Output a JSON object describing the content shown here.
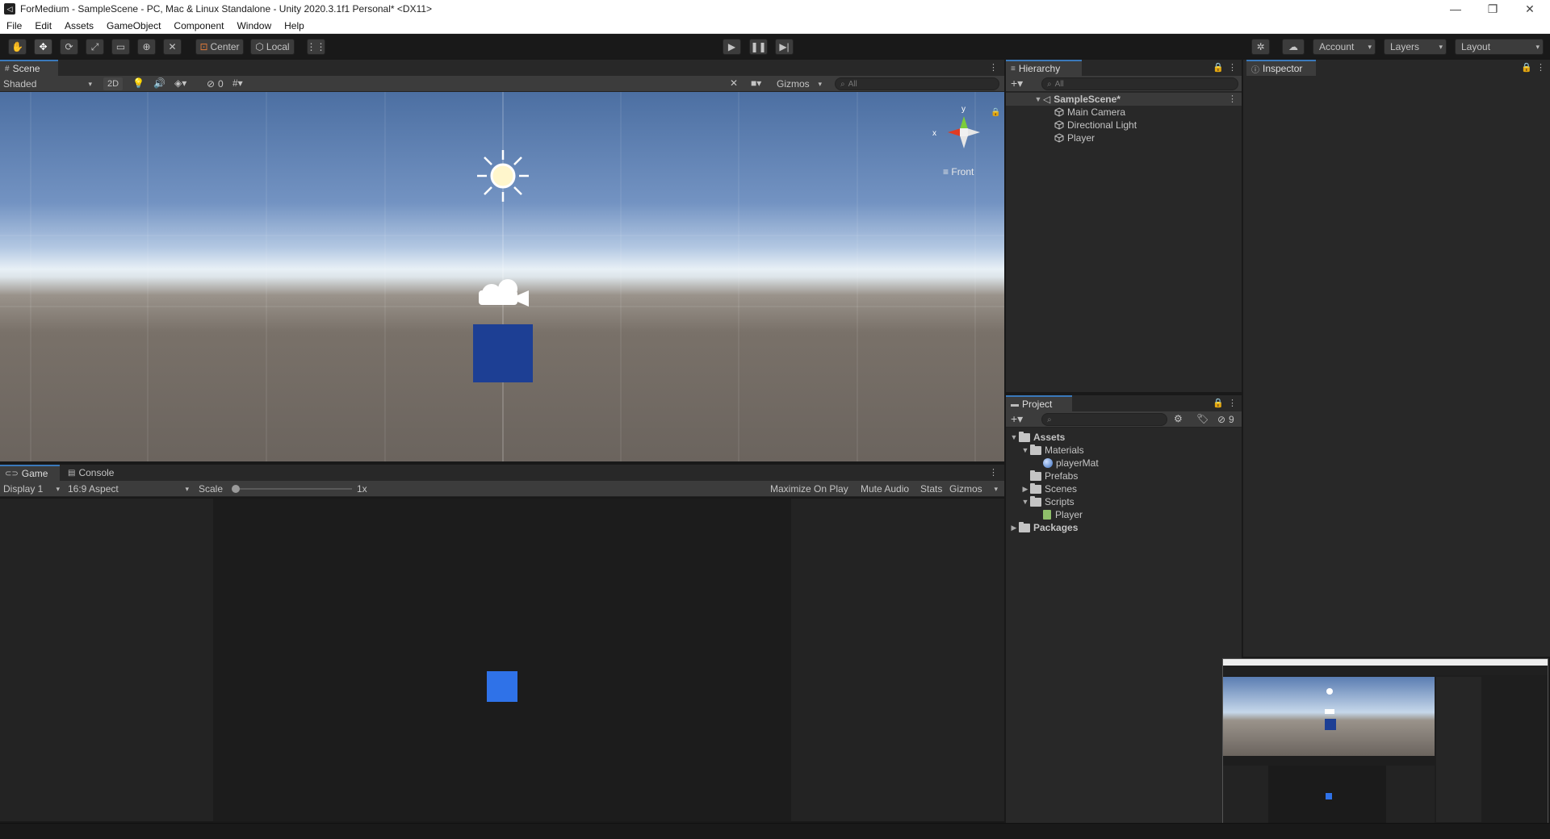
{
  "window": {
    "title": "ForMedium - SampleScene - PC, Mac & Linux Standalone - Unity 2020.3.1f1 Personal* <DX11>",
    "controls": [
      "—",
      "❐",
      "✕"
    ]
  },
  "menu": [
    "File",
    "Edit",
    "Assets",
    "GameObject",
    "Component",
    "Window",
    "Help"
  ],
  "toolbar": {
    "pivot_label": "Center",
    "space_label": "Local",
    "account_label": "Account",
    "layers_label": "Layers",
    "layout_label": "Layout"
  },
  "scene": {
    "tab_label": "Scene",
    "shading_mode": "Shaded",
    "mode_2d": "2D",
    "hidden_count": "0",
    "gizmos_label": "Gizmos",
    "search_placeholder": "All",
    "gizmo_axis_y": "y",
    "gizmo_axis_x": "x",
    "view_label": "Front"
  },
  "game": {
    "tab_label": "Game",
    "console_tab_label": "Console",
    "display": "Display 1",
    "aspect": "16:9 Aspect",
    "scale_label": "Scale",
    "scale_value": "1x",
    "scale_fraction": 0.0,
    "maximize_label": "Maximize On Play",
    "mute_label": "Mute Audio",
    "stats_label": "Stats",
    "gizmos_label": "Gizmos"
  },
  "hierarchy": {
    "tab_label": "Hierarchy",
    "search_placeholder": "All",
    "scene_name": "SampleScene*",
    "items": [
      "Main Camera",
      "Directional Light",
      "Player"
    ]
  },
  "project": {
    "tab_label": "Project",
    "hidden_count": "9",
    "tree": {
      "assets": "Assets",
      "materials": "Materials",
      "player_mat": "playerMat",
      "prefabs": "Prefabs",
      "scenes": "Scenes",
      "scripts": "Scripts",
      "player_script": "Player",
      "packages": "Packages"
    }
  },
  "inspector": {
    "tab_label": "Inspector"
  },
  "colors": {
    "accent": "#3a79bb",
    "player_cube_scene": "#1d3f94",
    "player_cube_game": "#2f72e8"
  }
}
